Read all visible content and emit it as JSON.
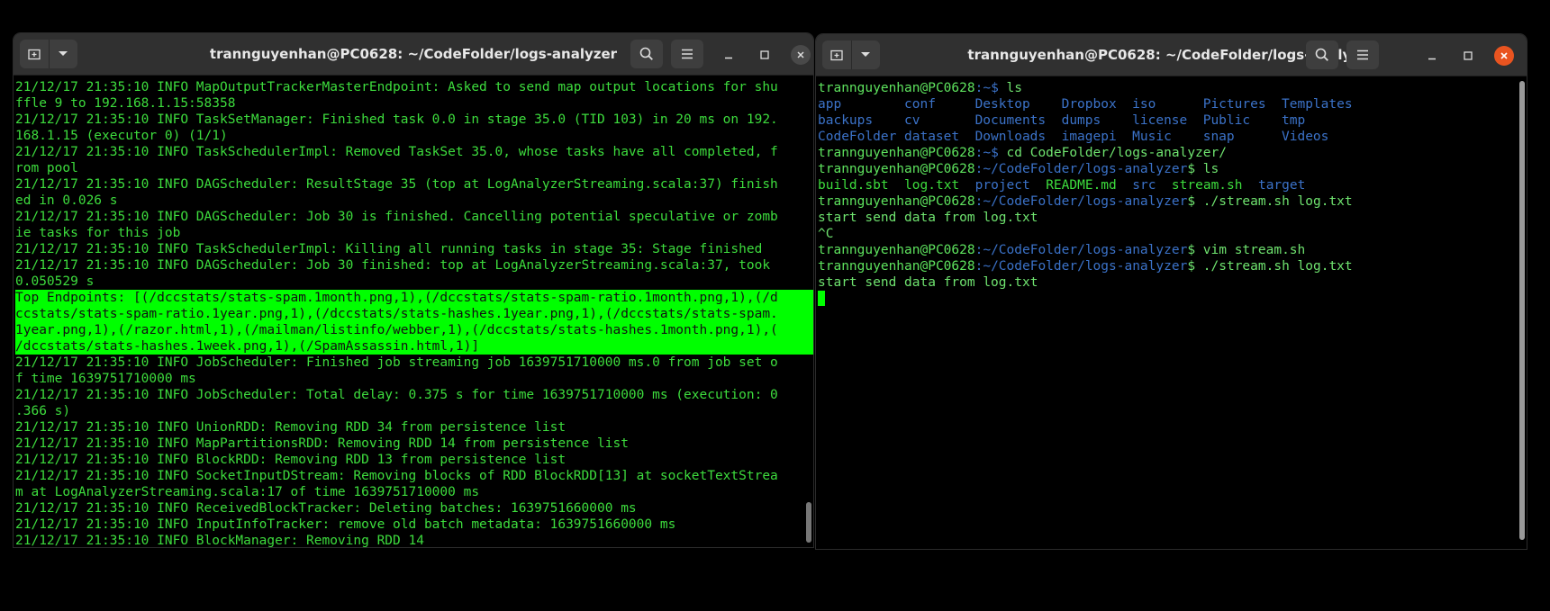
{
  "left_window": {
    "title": "trannguyenhan@PC0628: ~/CodeFolder/logs-analyzer",
    "lines": [
      "21/12/17 21:35:10 INFO MapOutputTrackerMasterEndpoint: Asked to send map output locations for shu",
      "ffle 9 to 192.168.1.15:58358",
      "21/12/17 21:35:10 INFO TaskSetManager: Finished task 0.0 in stage 35.0 (TID 103) in 20 ms on 192.",
      "168.1.15 (executor 0) (1/1)",
      "21/12/17 21:35:10 INFO TaskSchedulerImpl: Removed TaskSet 35.0, whose tasks have all completed, f",
      "rom pool",
      "21/12/17 21:35:10 INFO DAGScheduler: ResultStage 35 (top at LogAnalyzerStreaming.scala:37) finish",
      "ed in 0.026 s",
      "21/12/17 21:35:10 INFO DAGScheduler: Job 30 is finished. Cancelling potential speculative or zomb",
      "ie tasks for this job",
      "21/12/17 21:35:10 INFO TaskSchedulerImpl: Killing all running tasks in stage 35: Stage finished",
      "21/12/17 21:35:10 INFO DAGScheduler: Job 30 finished: top at LogAnalyzerStreaming.scala:37, took",
      "0.050529 s"
    ],
    "highlight_lines": [
      "Top Endpoints: [(/dccstats/stats-spam.1month.png,1),(/dccstats/stats-spam-ratio.1month.png,1),(/d",
      "ccstats/stats-spam-ratio.1year.png,1),(/dccstats/stats-hashes.1year.png,1),(/dccstats/stats-spam.",
      "1year.png,1),(/razor.html,1),(/mailman/listinfo/webber,1),(/dccstats/stats-hashes.1month.png,1),(",
      "/dccstats/stats-hashes.1week.png,1),(/SpamAssassin.html,1)]"
    ],
    "lines_after": [
      "21/12/17 21:35:10 INFO JobScheduler: Finished job streaming job 1639751710000 ms.0 from job set o",
      "f time 1639751710000 ms",
      "21/12/17 21:35:10 INFO JobScheduler: Total delay: 0.375 s for time 1639751710000 ms (execution: 0",
      ".366 s)",
      "21/12/17 21:35:10 INFO UnionRDD: Removing RDD 34 from persistence list",
      "21/12/17 21:35:10 INFO MapPartitionsRDD: Removing RDD 14 from persistence list",
      "21/12/17 21:35:10 INFO BlockRDD: Removing RDD 13 from persistence list",
      "21/12/17 21:35:10 INFO SocketInputDStream: Removing blocks of RDD BlockRDD[13] at socketTextStrea",
      "m at LogAnalyzerStreaming.scala:17 of time 1639751710000 ms",
      "21/12/17 21:35:10 INFO ReceivedBlockTracker: Deleting batches: 1639751660000 ms",
      "21/12/17 21:35:10 INFO InputInfoTracker: remove old batch metadata: 1639751660000 ms",
      "21/12/17 21:35:10 INFO BlockManager: Removing RDD 14"
    ]
  },
  "right_window": {
    "title": "trannguyenhan@PC0628: ~/CodeFolder/logs-analyzer",
    "prompt_user": "trannguyenhan@PC0628",
    "prompt_home": ":~$ ",
    "prompt_path": ":~/CodeFolder/logs-analyzer",
    "prompt_dollar": "$ ",
    "cmd1": "ls",
    "ls1_rows": [
      [
        "app",
        "conf",
        "Desktop",
        "Dropbox",
        "iso",
        "Pictures",
        "Templates"
      ],
      [
        "backups",
        "cv",
        "Documents",
        "dumps",
        "license",
        "Public",
        "tmp"
      ],
      [
        "CodeFolder",
        "dataset",
        "Downloads",
        "imagepi",
        "Music",
        "snap",
        "Videos"
      ]
    ],
    "ls1_col_widths": [
      11,
      9,
      11,
      9,
      9,
      10,
      10
    ],
    "cmd2": "cd CodeFolder/logs-analyzer/",
    "cmd3": "ls",
    "ls2": {
      "f1": "build.sbt",
      "f2": "log.txt",
      "d1": "project",
      "f3": "README.md",
      "d2": "src",
      "f4": "stream.sh",
      "d3": "target"
    },
    "cmd4": "./stream.sh log.txt",
    "out1": "start send data from log.txt",
    "out2": "^C",
    "cmd5": "vim stream.sh",
    "cmd6": "./stream.sh log.txt",
    "out3": "start send data from log.txt"
  },
  "colors": {
    "log_green": "#3ddc3d",
    "highlight_bg": "#00ff00",
    "path_blue": "#3b72c8",
    "close_orange": "#e95420"
  }
}
